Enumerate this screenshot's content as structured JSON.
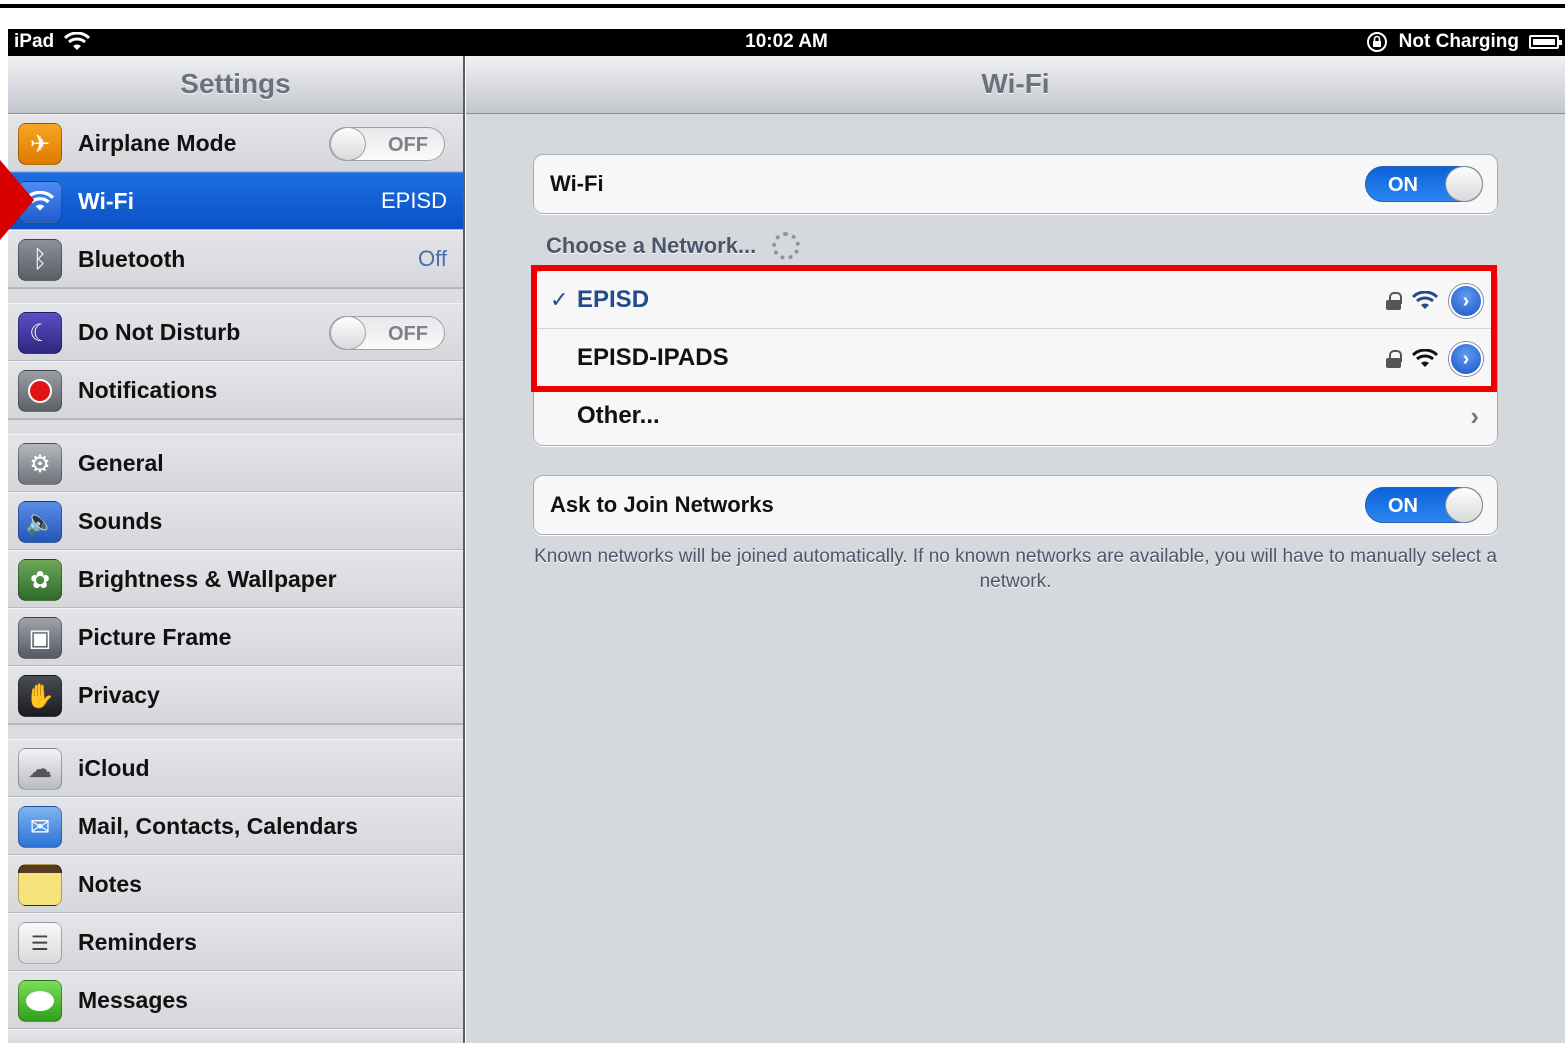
{
  "status_bar": {
    "device": "iPad",
    "time": "10:02 AM",
    "battery_status": "Not Charging"
  },
  "sidebar": {
    "title": "Settings",
    "groups": [
      [
        {
          "label": "Airplane Mode",
          "icon": "airplane-icon",
          "control": "switch",
          "state": "OFF"
        },
        {
          "label": "Wi-Fi",
          "icon": "wifi-icon",
          "value": "EPISD",
          "selected": true
        },
        {
          "label": "Bluetooth",
          "icon": "bluetooth-icon",
          "value": "Off"
        }
      ],
      [
        {
          "label": "Do Not Disturb",
          "icon": "moon-icon",
          "control": "switch",
          "state": "OFF"
        },
        {
          "label": "Notifications",
          "icon": "notifications-icon"
        }
      ],
      [
        {
          "label": "General",
          "icon": "gear-icon"
        },
        {
          "label": "Sounds",
          "icon": "speaker-icon"
        },
        {
          "label": "Brightness & Wallpaper",
          "icon": "flower-icon"
        },
        {
          "label": "Picture Frame",
          "icon": "picture-frame-icon"
        },
        {
          "label": "Privacy",
          "icon": "hand-icon"
        }
      ],
      [
        {
          "label": "iCloud",
          "icon": "cloud-icon"
        },
        {
          "label": "Mail, Contacts, Calendars",
          "icon": "mail-icon"
        },
        {
          "label": "Notes",
          "icon": "notes-icon"
        },
        {
          "label": "Reminders",
          "icon": "reminders-icon"
        },
        {
          "label": "Messages",
          "icon": "messages-icon"
        }
      ]
    ]
  },
  "main": {
    "title": "Wi-Fi",
    "wifi_toggle": {
      "label": "Wi-Fi",
      "state": "ON"
    },
    "choose_network_label": "Choose a Network...",
    "networks": [
      {
        "name": "EPISD",
        "connected": true,
        "check": "✓",
        "secured": true
      },
      {
        "name": "EPISD-IPADS",
        "connected": false,
        "secured": true
      }
    ],
    "other_label": "Other...",
    "ask_to_join": {
      "label": "Ask to Join Networks",
      "state": "ON"
    },
    "footnote": "Known networks will be joined automatically. If no known networks are available, you will have to manually select a network."
  },
  "colors": {
    "accent": "#0b50c7",
    "highlight_box": "#ee0000"
  }
}
